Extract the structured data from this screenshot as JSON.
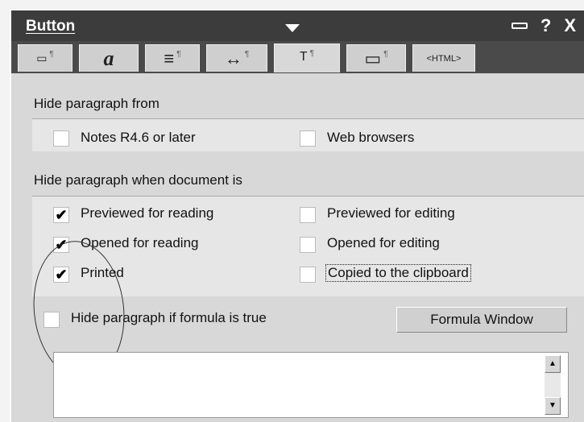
{
  "window": {
    "title": "Button",
    "help_label": "?",
    "close_label": "X"
  },
  "tabs": [
    {
      "name": "field-info-tab",
      "glyph": "▭"
    },
    {
      "name": "font-tab",
      "glyph": "a"
    },
    {
      "name": "paragraph-alignment-tab",
      "glyph": "≡"
    },
    {
      "name": "paragraph-margins-tab",
      "glyph": "↔"
    },
    {
      "name": "paragraph-hide-tab",
      "glyph": "ᵀ"
    },
    {
      "name": "paragraph-style-tab",
      "glyph": "▭"
    },
    {
      "name": "html-tab",
      "glyph": "<HTML>"
    }
  ],
  "hide_from": {
    "label": "Hide paragraph from",
    "notes": {
      "label": "Notes R4.6 or later",
      "checked": false
    },
    "web": {
      "label": "Web browsers",
      "checked": false
    }
  },
  "hide_when": {
    "label": "Hide paragraph when document is",
    "previewed_reading": {
      "label": "Previewed for reading",
      "checked": true
    },
    "opened_reading": {
      "label": "Opened for reading",
      "checked": true
    },
    "printed": {
      "label": "Printed",
      "checked": true
    },
    "previewed_editing": {
      "label": "Previewed for editing",
      "checked": false
    },
    "opened_editing": {
      "label": "Opened for editing",
      "checked": false
    },
    "copied_clipboard": {
      "label": "Copied to the clipboard",
      "checked": false
    }
  },
  "formula": {
    "label": "Hide paragraph if formula is true",
    "checked": false,
    "window_button": "Formula Window",
    "value": ""
  },
  "check_mark": "✔"
}
